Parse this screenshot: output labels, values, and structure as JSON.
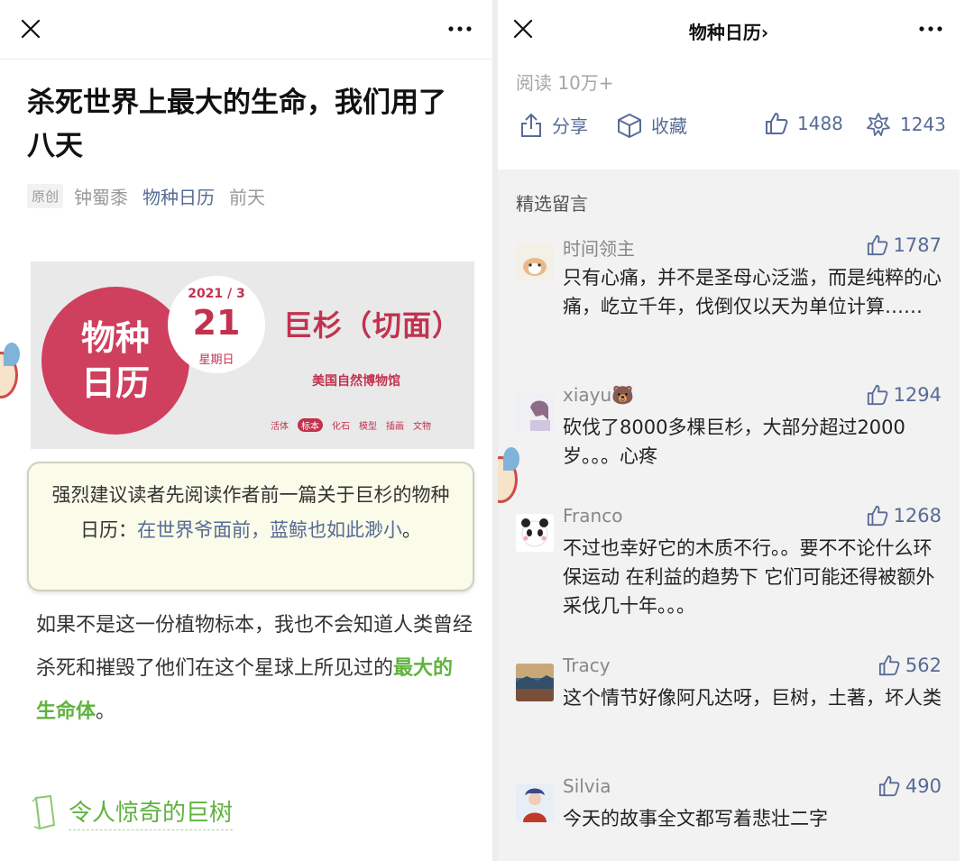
{
  "left": {
    "article_title": "杀死世界上最大的生命，我们用了八天",
    "meta": {
      "badge": "原创",
      "author": "钟蜀黍",
      "account": "物种日历",
      "time": "前天"
    },
    "banner": {
      "brand_line1": "物种",
      "brand_line2": "日历",
      "date_ym": "2021 / 3",
      "date_day": "21",
      "weekday": "星期日",
      "species": "巨杉（切面）",
      "museum": "美国自然博物馆",
      "tags": [
        "活体",
        "标本",
        "化石",
        "模型",
        "插画",
        "文物"
      ],
      "active_tag": "标本"
    },
    "callout": {
      "text_before": "强烈建议读者先阅读作者前一篇关于巨杉的物种日历：",
      "link": "在世界爷面前，蓝鲸也如此渺小",
      "text_after": "。"
    },
    "body": {
      "text_before": "如果不是这一份植物标本，我也不会知道人类曾经杀死和摧毁了他们在这个星球上所见过的",
      "highlight": "最大的生命体",
      "text_after": "。"
    },
    "section_heading": "令人惊奇的巨树"
  },
  "right": {
    "title": "物种日历",
    "title_chevron": "›",
    "read_count": "阅读 10万+",
    "actions": {
      "share": "分享",
      "favorite": "收藏",
      "likes": "1488",
      "wow": "1243"
    },
    "featured_label": "精选留言",
    "comments": [
      {
        "nick": "时间领主",
        "likes": "1787",
        "text": "只有心痛，并不是圣母心泛滥，而是纯粹的心痛，屹立千年，伐倒仅以天为单位计算……"
      },
      {
        "nick": "xiayu🐻",
        "likes": "1294",
        "text": "砍伐了8000多棵巨杉，大部分超过2000岁。。。心疼"
      },
      {
        "nick": "Franco",
        "likes": "1268",
        "text": "不过也幸好它的木质不行。。要不不论什么环保运动 在利益的趋势下 它们可能还得被额外采伐几十年。。。"
      },
      {
        "nick": "Tracy",
        "likes": "562",
        "text": "这个情节好像阿凡达呀，巨树，土著，坏人类"
      },
      {
        "nick": "Silvia",
        "likes": "490",
        "text": "今天的故事全文都写着悲壮二字"
      }
    ]
  },
  "colors": {
    "link": "#576b95",
    "highlight_green": "#5fb33f",
    "brand_red": "#cf3f5e"
  }
}
